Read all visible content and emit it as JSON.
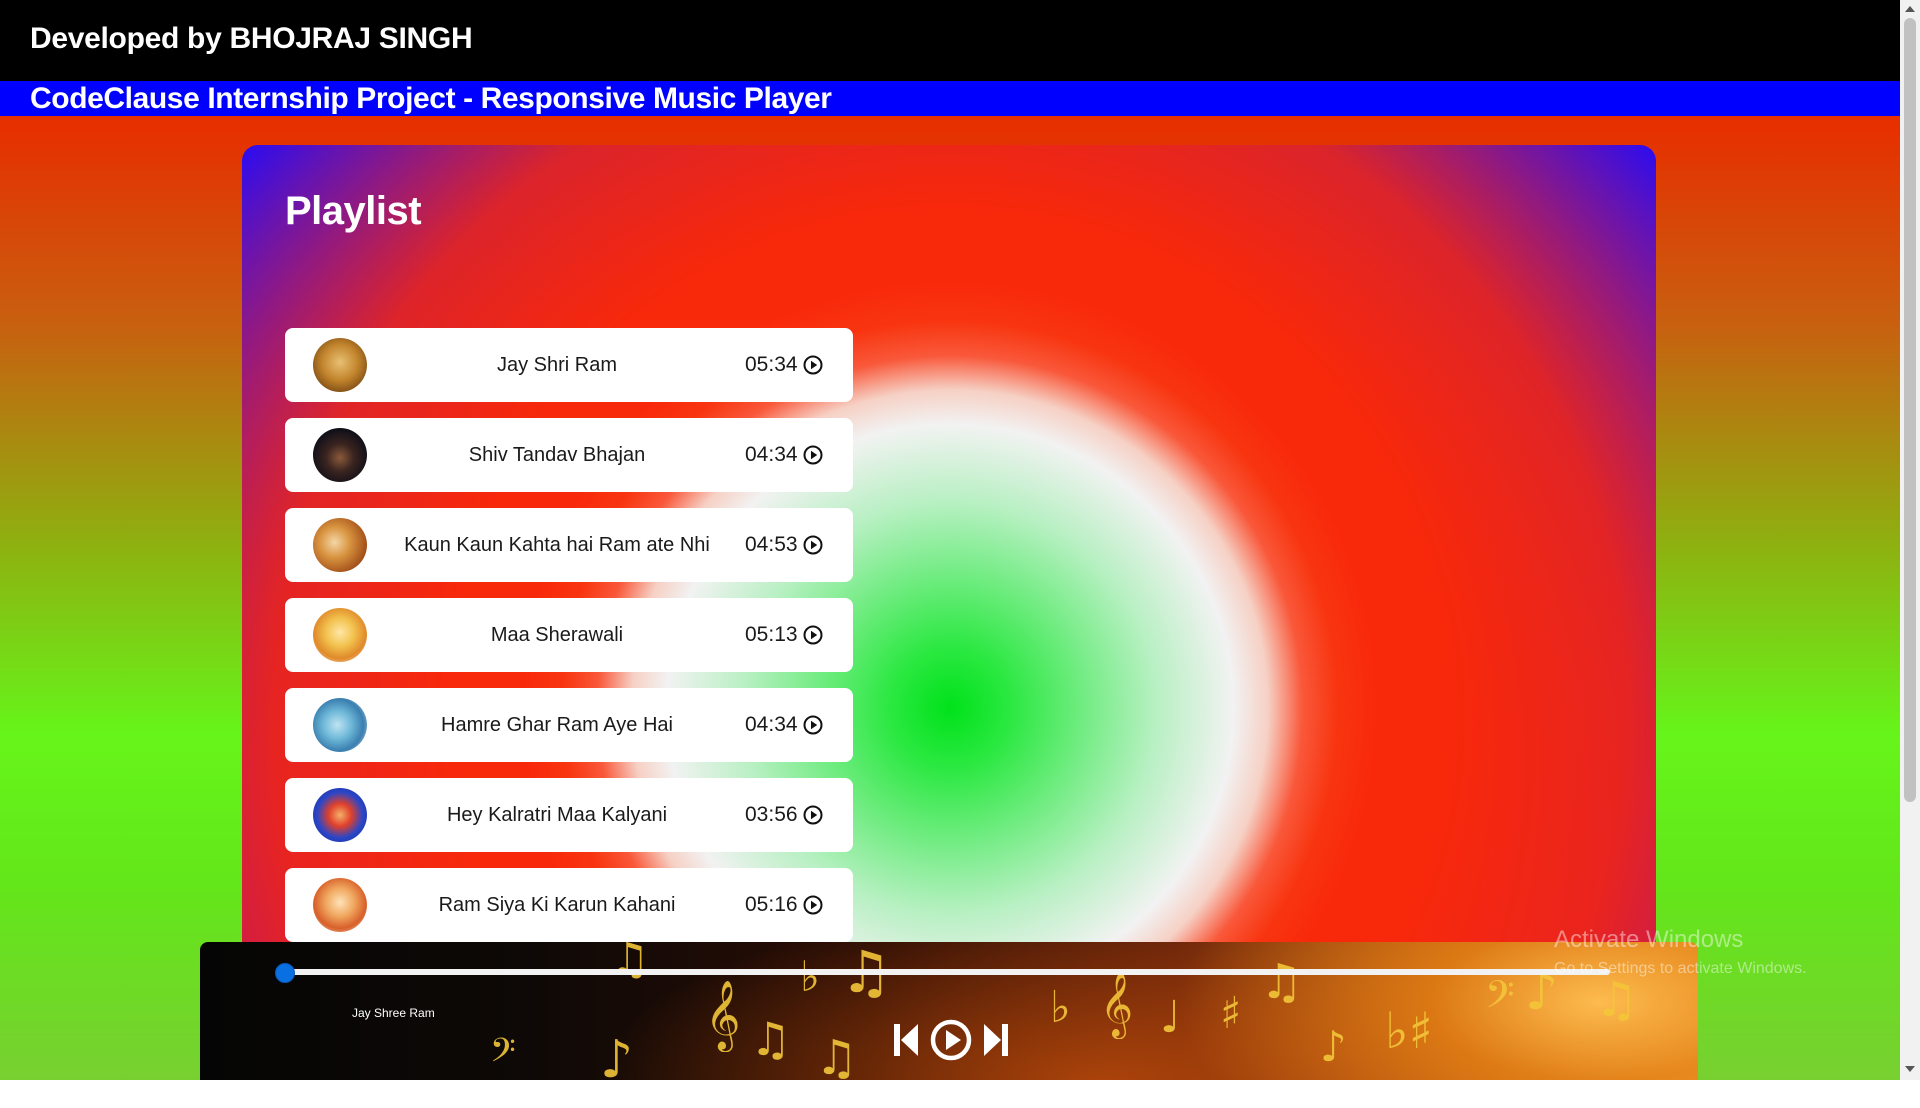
{
  "header": {
    "developer": "Developed by BHOJRAJ SINGH",
    "project": "CodeClause Internship Project - Responsive Music Player"
  },
  "playlist": {
    "heading": "Playlist",
    "songs": [
      {
        "title": "Jay Shri Ram",
        "duration": "05:34"
      },
      {
        "title": "Shiv Tandav Bhajan",
        "duration": "04:34"
      },
      {
        "title": "Kaun Kaun Kahta hai Ram ate Nhi",
        "duration": "04:53"
      },
      {
        "title": "Maa Sherawali",
        "duration": "05:13"
      },
      {
        "title": "Hamre Ghar Ram Aye Hai",
        "duration": "04:34"
      },
      {
        "title": "Hey Kalratri Maa Kalyani",
        "duration": "03:56"
      },
      {
        "title": "Ram Siya Ki Karun Kahani",
        "duration": "05:16"
      }
    ]
  },
  "player": {
    "now_playing": "Jay Shree Ram",
    "progress": 0,
    "controls": [
      "previous-icon",
      "play-icon",
      "next-icon"
    ]
  },
  "watermark": {
    "title": "Activate Windows",
    "subtitle": "Go to Settings to activate Windows."
  },
  "colors": {
    "header_bg": "#000000",
    "subheader_bg": "#0000ff",
    "seek_thumb": "#0a6fe0"
  }
}
